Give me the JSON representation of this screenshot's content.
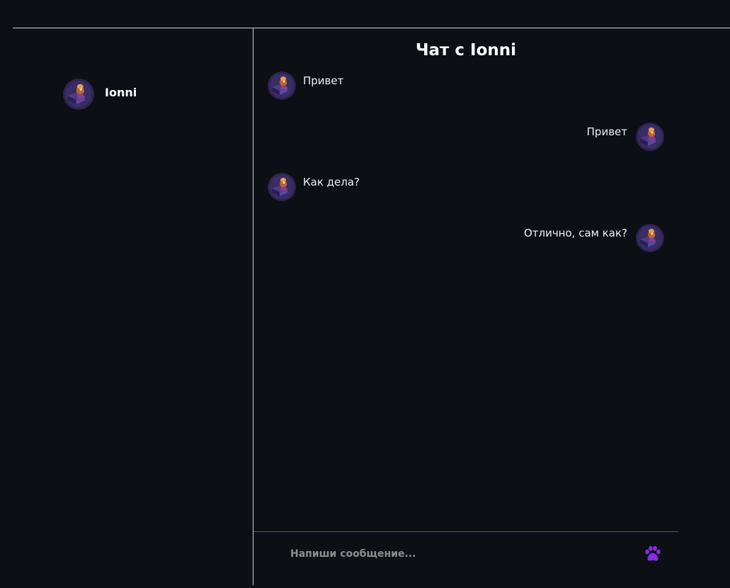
{
  "colors": {
    "background": "#0c1014",
    "divider": "#cfd3d8",
    "accent": "#8a2be2",
    "text": "#eef0f2",
    "placeholder": "#8e8e8e"
  },
  "sidebar": {
    "contacts": [
      {
        "name": "Ionni",
        "avatar_icon": "avatar-icon"
      }
    ]
  },
  "chat": {
    "title": "Чат с Ionni",
    "messages": [
      {
        "direction": "incoming",
        "text": "Привет"
      },
      {
        "direction": "outgoing",
        "text": "Привет"
      },
      {
        "direction": "incoming",
        "text": "Как дела?"
      },
      {
        "direction": "outgoing",
        "text": "Отлично, сам как?"
      }
    ]
  },
  "composer": {
    "placeholder": "Напиши сообщение...",
    "value": "",
    "send_icon": "paw-icon"
  }
}
